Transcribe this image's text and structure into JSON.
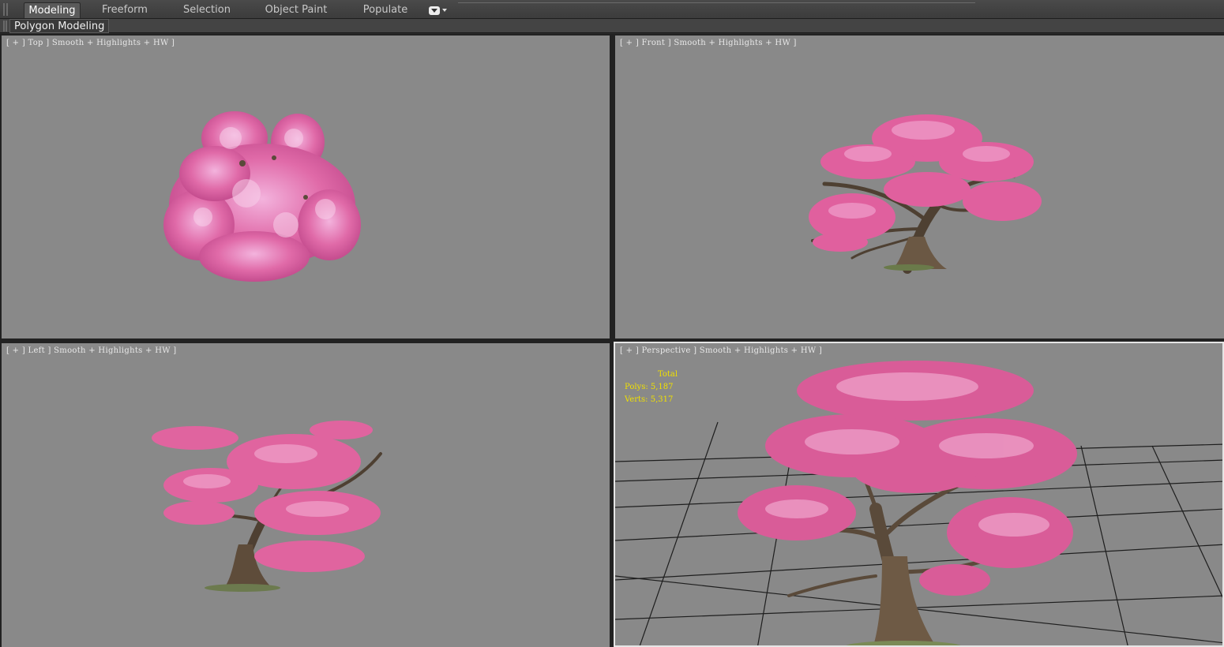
{
  "ribbon": {
    "tabs": [
      "Modeling",
      "Freeform",
      "Selection",
      "Object Paint",
      "Populate"
    ],
    "active_tab": "Modeling",
    "panel_label": "Polygon Modeling"
  },
  "viewports": {
    "top": {
      "label": "[ + ] Top ] Smooth + Highlights + HW ]"
    },
    "front": {
      "label": "[ + ] Front ] Smooth + Highlights + HW ]"
    },
    "left": {
      "label": "[ + ] Left ] Smooth + Highlights + HW ]"
    },
    "perspective": {
      "label": "[ + ] Perspective ] Smooth + Highlights + HW ]"
    }
  },
  "stats": {
    "total_label": "Total",
    "polys": "Polys: 5,187",
    "verts": "Verts: 5,317"
  },
  "colors": {
    "viewport_bg": "#898989",
    "blossom": "#e06aa8",
    "bark": "#5a4a3a",
    "stats_text": "#f0e000"
  }
}
